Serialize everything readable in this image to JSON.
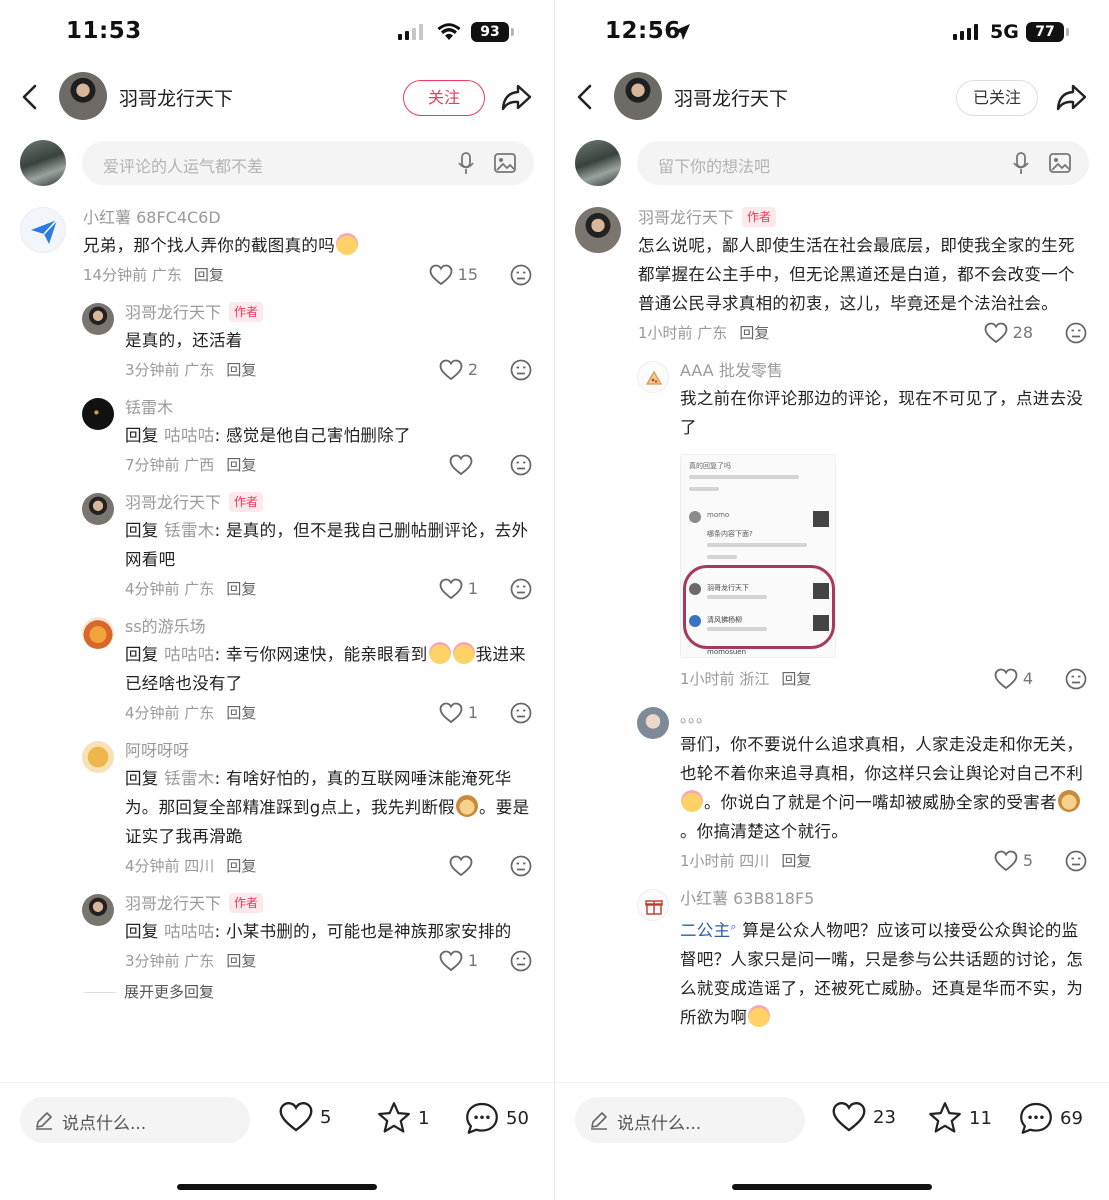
{
  "left": {
    "status": {
      "time": "11:53",
      "battery": "93"
    },
    "header": {
      "name": "羽哥龙行天下",
      "follow_label": "关注"
    },
    "comment_input": {
      "placeholder": "爱评论的人运气都不差"
    },
    "comments": [
      {
        "user": "小红薯 68FC4C6D",
        "text": "兄弟，那个找人弄你的截图真的吗",
        "time": "14分钟前 广东",
        "reply": "回复",
        "likes": "15"
      },
      {
        "user": "羽哥龙行天下",
        "author_tag": "作者",
        "text": "是真的，还活着",
        "time": "3分钟前 广东",
        "reply": "回复",
        "likes": "2"
      },
      {
        "user": "铥雷木",
        "reply_prefix": "回复 ",
        "mention": "咕咕咕",
        "text": ": 感觉是他自己害怕删除了",
        "time": "7分钟前 广西",
        "reply": "回复",
        "likes": ""
      },
      {
        "user": "羽哥龙行天下",
        "author_tag": "作者",
        "reply_prefix": "回复 ",
        "mention": "铥雷木",
        "text": ": 是真的，但不是我自己删帖删评论，去外网看吧",
        "time": "4分钟前 广东",
        "reply": "回复",
        "likes": "1"
      },
      {
        "user": "ss的游乐场",
        "reply_prefix": "回复 ",
        "mention": "咕咕咕",
        "text": ": 幸亏你网速快，能亲眼看到",
        "text2": "我进来已经啥也没有了",
        "time": "4分钟前 广东",
        "reply": "回复",
        "likes": "1"
      },
      {
        "user": "阿呀呀呀",
        "reply_prefix": "回复 ",
        "mention": "铥雷木",
        "text": ": 有啥好怕的，真的互联网唾沫能淹死华为。那回复全部精准踩到g点上，我先判断假",
        "text2": "。要是证实了我再滑跪",
        "time": "4分钟前 四川",
        "reply": "回复",
        "likes": ""
      },
      {
        "user": "羽哥龙行天下",
        "author_tag": "作者",
        "reply_prefix": "回复 ",
        "mention": "咕咕咕",
        "text": ": 小某书删的，可能也是神族那家安排的",
        "time": "3分钟前 广东",
        "reply": "回复",
        "likes": "1"
      }
    ],
    "more_replies": "展开更多回复",
    "bottom": {
      "say_placeholder": "说点什么...",
      "likes": "5",
      "stars": "1",
      "comments": "50"
    }
  },
  "right": {
    "status": {
      "time": "12:56",
      "network": "5G",
      "battery": "77"
    },
    "header": {
      "name": "羽哥龙行天下",
      "follow_label": "已关注"
    },
    "comment_input": {
      "placeholder": "留下你的想法吧"
    },
    "comments": [
      {
        "user": "羽哥龙行天下",
        "author_tag": "作者",
        "text": "怎么说呢，鄙人即使生活在社会最底层，即使我全家的生死都掌握在公主手中，但无论黑道还是白道，都不会改变一个普通公民寻求真相的初衷，这儿，毕竟还是个法治社会。",
        "time": "1小时前 广东",
        "reply": "回复",
        "likes": "28"
      },
      {
        "user": "AAA 批发零售",
        "text": "我之前在你评论那边的评论，现在不可见了，点进去没了",
        "time": "1小时前 浙江",
        "reply": "回复",
        "likes": "4",
        "shot": {
          "line1": "真的回复了吗",
          "user_a": "momo",
          "user_a_text": "哪条内容下面?",
          "user_b": "羽哥龙行天下",
          "user_c": "清风拂杨柳",
          "user_d": "momosuen"
        }
      },
      {
        "user": "。。。",
        "text": "哥们，你不要说什么追求真相，人家走没走和你无关，也轮不着你来追寻真相，你这样只会让舆论对自己不利",
        "text2": "。你说白了就是个问一嘴却被威胁全家的受害者",
        "text3": "。你搞清楚这个就行。",
        "time": "1小时前 四川",
        "reply": "回复",
        "likes": "5"
      },
      {
        "user": "小红薯 63B818F5",
        "topic": "二公主",
        "text": " 算是公众人物吧？应该可以接受公众舆论的监督吧？人家只是问一嘴，只是参与公共话题的讨论，怎么就变成造谣了，还被死亡威胁。还真是华而不实，为所欲为啊"
      }
    ],
    "bottom": {
      "say_placeholder": "说点什么...",
      "likes": "23",
      "stars": "11",
      "comments": "69"
    }
  },
  "colors": {
    "accent": "#f0395d",
    "link": "#2d5fa8",
    "muted": "#9a9a9a"
  },
  "icons": [
    "back-icon",
    "share-icon",
    "mic-icon",
    "image-icon",
    "heart-icon",
    "dislike-icon",
    "star-icon",
    "comment-icon",
    "pen-icon",
    "wifi-icon",
    "signal-icon",
    "location-arrow-icon"
  ]
}
